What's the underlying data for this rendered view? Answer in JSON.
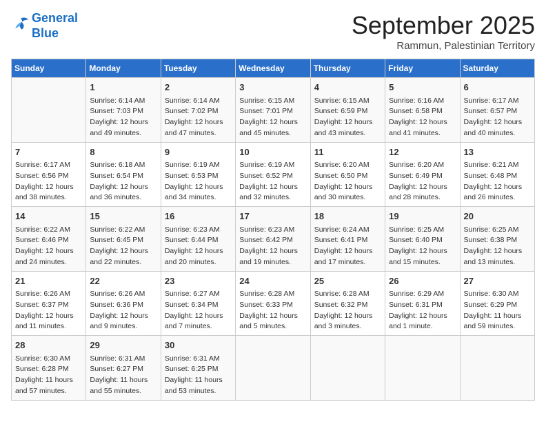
{
  "header": {
    "logo_line1": "General",
    "logo_line2": "Blue",
    "month": "September 2025",
    "location": "Rammun, Palestinian Territory"
  },
  "columns": [
    "Sunday",
    "Monday",
    "Tuesday",
    "Wednesday",
    "Thursday",
    "Friday",
    "Saturday"
  ],
  "rows": [
    [
      {
        "day": "",
        "info": ""
      },
      {
        "day": "1",
        "info": "Sunrise: 6:14 AM\nSunset: 7:03 PM\nDaylight: 12 hours\nand 49 minutes."
      },
      {
        "day": "2",
        "info": "Sunrise: 6:14 AM\nSunset: 7:02 PM\nDaylight: 12 hours\nand 47 minutes."
      },
      {
        "day": "3",
        "info": "Sunrise: 6:15 AM\nSunset: 7:01 PM\nDaylight: 12 hours\nand 45 minutes."
      },
      {
        "day": "4",
        "info": "Sunrise: 6:15 AM\nSunset: 6:59 PM\nDaylight: 12 hours\nand 43 minutes."
      },
      {
        "day": "5",
        "info": "Sunrise: 6:16 AM\nSunset: 6:58 PM\nDaylight: 12 hours\nand 41 minutes."
      },
      {
        "day": "6",
        "info": "Sunrise: 6:17 AM\nSunset: 6:57 PM\nDaylight: 12 hours\nand 40 minutes."
      }
    ],
    [
      {
        "day": "7",
        "info": "Sunrise: 6:17 AM\nSunset: 6:56 PM\nDaylight: 12 hours\nand 38 minutes."
      },
      {
        "day": "8",
        "info": "Sunrise: 6:18 AM\nSunset: 6:54 PM\nDaylight: 12 hours\nand 36 minutes."
      },
      {
        "day": "9",
        "info": "Sunrise: 6:19 AM\nSunset: 6:53 PM\nDaylight: 12 hours\nand 34 minutes."
      },
      {
        "day": "10",
        "info": "Sunrise: 6:19 AM\nSunset: 6:52 PM\nDaylight: 12 hours\nand 32 minutes."
      },
      {
        "day": "11",
        "info": "Sunrise: 6:20 AM\nSunset: 6:50 PM\nDaylight: 12 hours\nand 30 minutes."
      },
      {
        "day": "12",
        "info": "Sunrise: 6:20 AM\nSunset: 6:49 PM\nDaylight: 12 hours\nand 28 minutes."
      },
      {
        "day": "13",
        "info": "Sunrise: 6:21 AM\nSunset: 6:48 PM\nDaylight: 12 hours\nand 26 minutes."
      }
    ],
    [
      {
        "day": "14",
        "info": "Sunrise: 6:22 AM\nSunset: 6:46 PM\nDaylight: 12 hours\nand 24 minutes."
      },
      {
        "day": "15",
        "info": "Sunrise: 6:22 AM\nSunset: 6:45 PM\nDaylight: 12 hours\nand 22 minutes."
      },
      {
        "day": "16",
        "info": "Sunrise: 6:23 AM\nSunset: 6:44 PM\nDaylight: 12 hours\nand 20 minutes."
      },
      {
        "day": "17",
        "info": "Sunrise: 6:23 AM\nSunset: 6:42 PM\nDaylight: 12 hours\nand 19 minutes."
      },
      {
        "day": "18",
        "info": "Sunrise: 6:24 AM\nSunset: 6:41 PM\nDaylight: 12 hours\nand 17 minutes."
      },
      {
        "day": "19",
        "info": "Sunrise: 6:25 AM\nSunset: 6:40 PM\nDaylight: 12 hours\nand 15 minutes."
      },
      {
        "day": "20",
        "info": "Sunrise: 6:25 AM\nSunset: 6:38 PM\nDaylight: 12 hours\nand 13 minutes."
      }
    ],
    [
      {
        "day": "21",
        "info": "Sunrise: 6:26 AM\nSunset: 6:37 PM\nDaylight: 12 hours\nand 11 minutes."
      },
      {
        "day": "22",
        "info": "Sunrise: 6:26 AM\nSunset: 6:36 PM\nDaylight: 12 hours\nand 9 minutes."
      },
      {
        "day": "23",
        "info": "Sunrise: 6:27 AM\nSunset: 6:34 PM\nDaylight: 12 hours\nand 7 minutes."
      },
      {
        "day": "24",
        "info": "Sunrise: 6:28 AM\nSunset: 6:33 PM\nDaylight: 12 hours\nand 5 minutes."
      },
      {
        "day": "25",
        "info": "Sunrise: 6:28 AM\nSunset: 6:32 PM\nDaylight: 12 hours\nand 3 minutes."
      },
      {
        "day": "26",
        "info": "Sunrise: 6:29 AM\nSunset: 6:31 PM\nDaylight: 12 hours\nand 1 minute."
      },
      {
        "day": "27",
        "info": "Sunrise: 6:30 AM\nSunset: 6:29 PM\nDaylight: 11 hours\nand 59 minutes."
      }
    ],
    [
      {
        "day": "28",
        "info": "Sunrise: 6:30 AM\nSunset: 6:28 PM\nDaylight: 11 hours\nand 57 minutes."
      },
      {
        "day": "29",
        "info": "Sunrise: 6:31 AM\nSunset: 6:27 PM\nDaylight: 11 hours\nand 55 minutes."
      },
      {
        "day": "30",
        "info": "Sunrise: 6:31 AM\nSunset: 6:25 PM\nDaylight: 11 hours\nand 53 minutes."
      },
      {
        "day": "",
        "info": ""
      },
      {
        "day": "",
        "info": ""
      },
      {
        "day": "",
        "info": ""
      },
      {
        "day": "",
        "info": ""
      }
    ]
  ]
}
